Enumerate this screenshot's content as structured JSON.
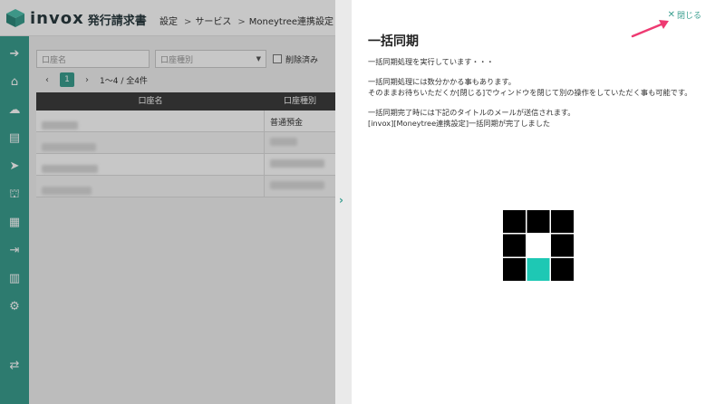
{
  "app": {
    "logo_text": "invox",
    "logo_sub": "発行請求書",
    "breadcrumbs": [
      "設定",
      "サービス",
      "Moneytree連携設定"
    ],
    "accent_color": "#3a9e8f"
  },
  "sidebar": {
    "items": [
      {
        "icon": "arrow-right-circle-icon",
        "glyph": "➔"
      },
      {
        "icon": "home-icon",
        "glyph": "⌂"
      },
      {
        "icon": "cloud-upload-icon",
        "glyph": "☁"
      },
      {
        "icon": "document-icon",
        "glyph": "▤"
      },
      {
        "icon": "send-icon",
        "glyph": "➤"
      },
      {
        "icon": "bank-icon",
        "glyph": "⛫"
      },
      {
        "icon": "building-icon",
        "glyph": "▦"
      },
      {
        "icon": "export-icon",
        "glyph": "⇥"
      },
      {
        "icon": "chart-icon",
        "glyph": "▥"
      },
      {
        "icon": "gear-icon",
        "glyph": "⚙"
      },
      {
        "icon": "transfer-icon",
        "glyph": "⇄"
      }
    ]
  },
  "filters": {
    "account_name_placeholder": "口座名",
    "account_type_placeholder": "口座種別",
    "deleted_label": "削除済み"
  },
  "pager": {
    "current_page": "1",
    "info": "1〜4 / 全4件"
  },
  "table": {
    "headers": [
      "口座名",
      "口座種別"
    ],
    "rows": [
      {
        "type": "普通預金"
      },
      {
        "type": ""
      },
      {
        "type": ""
      },
      {
        "type": ""
      }
    ]
  },
  "drawer": {
    "close_label": "閉じる",
    "title": "一括同期",
    "paragraphs": [
      [
        "一括同期処理を実行しています・・・"
      ],
      [
        "一括同期処理には数分かかる事もあります。",
        "そのままお待ちいただくか[閉じる]でウィンドウを閉じて別の操作をしていただく事も可能です。"
      ],
      [
        "一括同期完了時には下記のタイトルのメールが送信されます。",
        "[invox][Moneytree連携設定]一括同期が完了しました"
      ]
    ]
  },
  "loader": {
    "grid": [
      [
        "black",
        "black",
        "black"
      ],
      [
        "black",
        "white",
        "black"
      ],
      [
        "black",
        "teal",
        "black"
      ]
    ],
    "colors": {
      "black": "#000000",
      "white": "#ffffff",
      "teal": "#1ec8b4"
    }
  }
}
